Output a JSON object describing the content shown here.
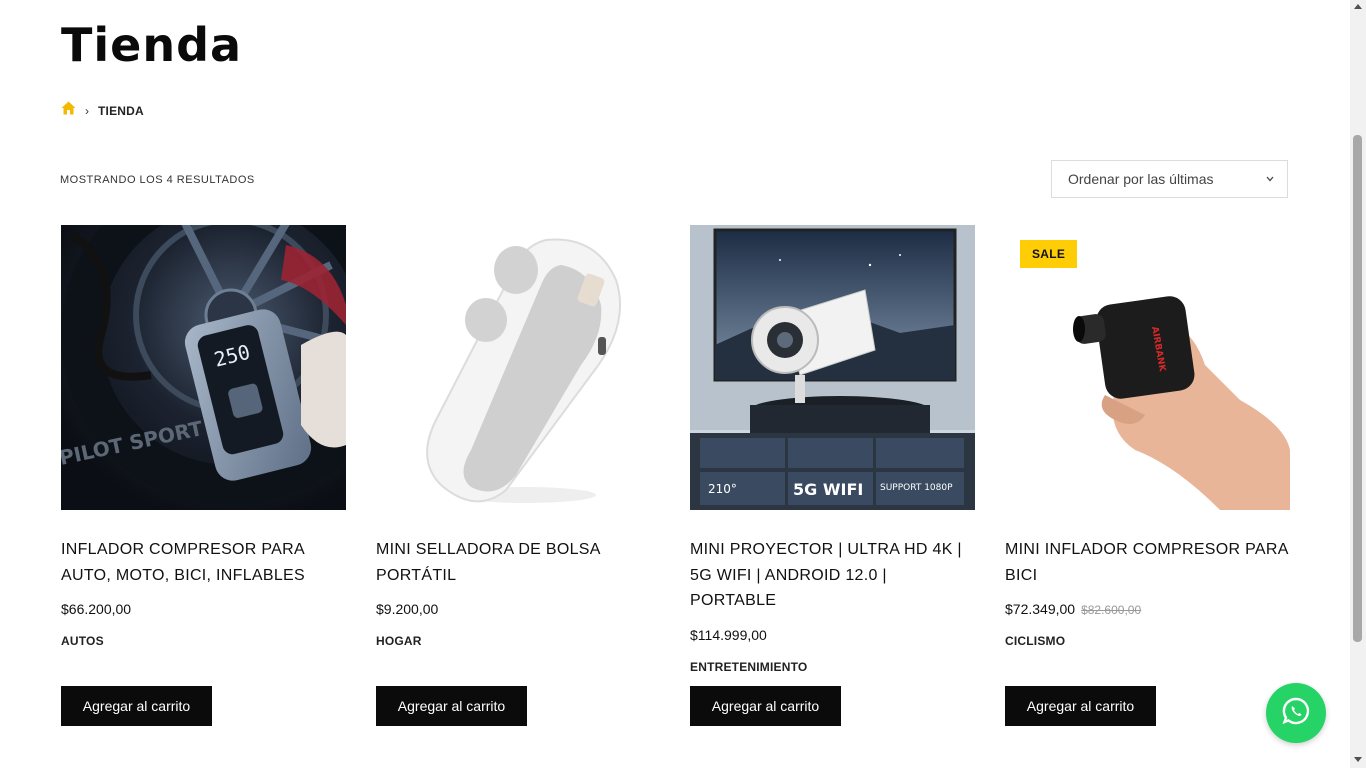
{
  "page": {
    "title": "Tienda"
  },
  "breadcrumb": {
    "home_icon": "home-icon",
    "separator": "›",
    "current": "TIENDA"
  },
  "shop": {
    "result_count": "MOSTRANDO LOS 4 RESULTADOS",
    "ordering": {
      "selected": "Ordenar por las últimas"
    }
  },
  "products": [
    {
      "name": "INFLADOR COMPRESOR PARA AUTO, MOTO, BICI, INFLABLES",
      "price": "$66.200,00",
      "category": "AUTOS",
      "button": "Agregar al carrito"
    },
    {
      "name": "MINI SELLADORA DE BOLSA PORTÁTIL",
      "price": "$9.200,00",
      "category": "HOGAR",
      "button": "Agregar al carrito"
    },
    {
      "name": "MINI PROYECTOR | ULTRA HD 4K | 5G WIFI | ANDROID 12.0 | PORTABLE",
      "price": "$114.999,00",
      "category": "ENTRETENIMIENTO",
      "button": "Agregar al carrito"
    },
    {
      "name": "MINI INFLADOR COMPRESOR PARA BICI",
      "price": "$72.349,00",
      "old_price": "$82.600,00",
      "category": "CICLISMO",
      "button": "Agregar al carrito",
      "badge": "SALE"
    }
  ],
  "projector_image_text": {
    "wifi": "5G WIFI",
    "angle": "210°",
    "support": "SUPPORT 1080P"
  },
  "inflator_image_text": {
    "display": "250"
  },
  "airbank_brand": "AIRBANK",
  "colors": {
    "accent": "#ffcd05",
    "button": "#0b0b0b",
    "whatsapp": "#25d366"
  }
}
